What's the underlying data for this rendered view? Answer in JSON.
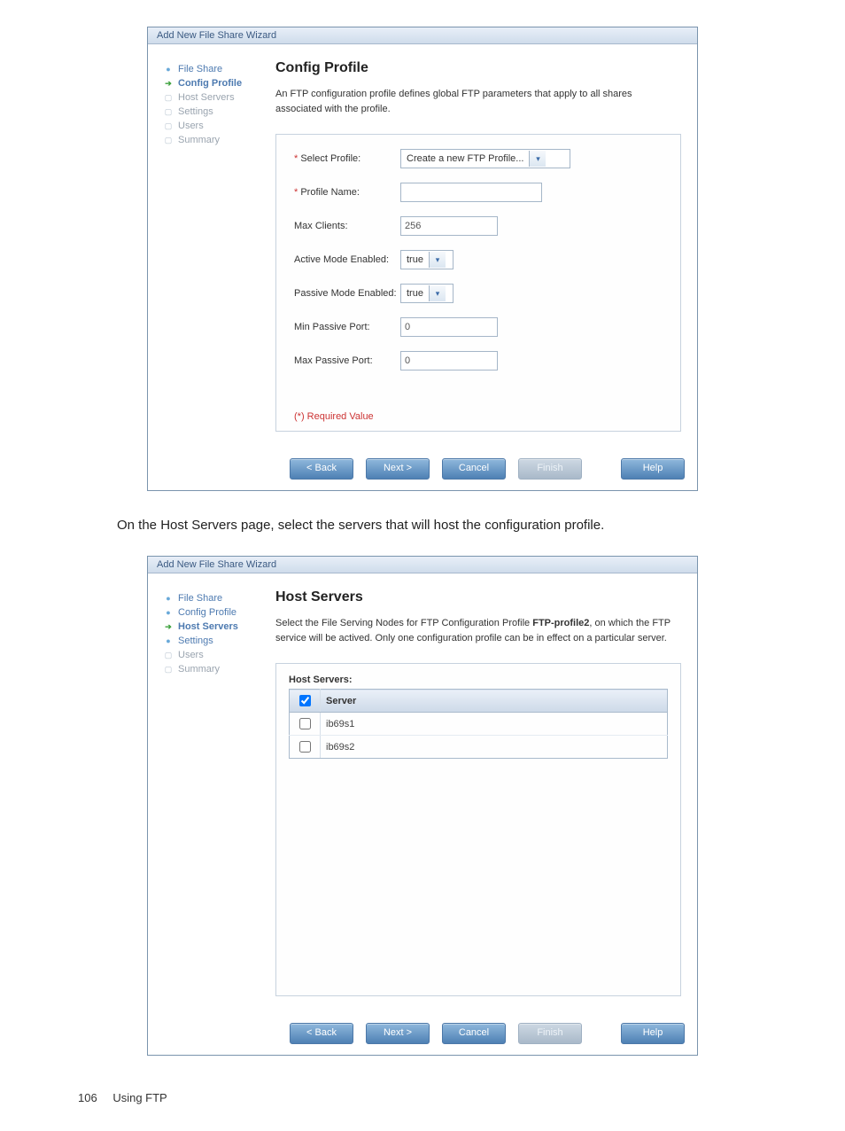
{
  "wizard1": {
    "title": "Add New File Share Wizard",
    "nav": [
      {
        "label": "File Share",
        "state": "done",
        "icon": "●"
      },
      {
        "label": "Config Profile",
        "state": "current",
        "icon": "➔"
      },
      {
        "label": "Host Servers",
        "state": "pending",
        "icon": "▢"
      },
      {
        "label": "Settings",
        "state": "pending",
        "icon": "▢"
      },
      {
        "label": "Users",
        "state": "pending",
        "icon": "▢"
      },
      {
        "label": "Summary",
        "state": "pending",
        "icon": "▢"
      }
    ],
    "panel_title": "Config Profile",
    "panel_desc": "An FTP configuration profile defines global FTP parameters that apply to all shares associated with the profile.",
    "fields": {
      "select_profile": {
        "label": "Select Profile:",
        "value": "Create a new FTP Profile..."
      },
      "profile_name": {
        "label": "Profile Name:",
        "value": ""
      },
      "max_clients": {
        "label": "Max Clients:",
        "value": "256"
      },
      "active_mode": {
        "label": "Active Mode Enabled:",
        "value": "true"
      },
      "passive_mode": {
        "label": "Passive Mode Enabled:",
        "value": "true"
      },
      "min_port": {
        "label": "Min Passive Port:",
        "value": "0"
      },
      "max_port": {
        "label": "Max Passive Port:",
        "value": "0"
      }
    },
    "required_note": "(*) Required Value",
    "buttons": {
      "back": "< Back",
      "next": "Next >",
      "cancel": "Cancel",
      "finish": "Finish",
      "help": "Help"
    }
  },
  "caption": "On the Host Servers page, select the servers that will host the configuration profile.",
  "wizard2": {
    "title": "Add New File Share Wizard",
    "nav": [
      {
        "label": "File Share",
        "state": "done",
        "icon": "●"
      },
      {
        "label": "Config Profile",
        "state": "done",
        "icon": "●"
      },
      {
        "label": "Host Servers",
        "state": "current",
        "icon": "➔"
      },
      {
        "label": "Settings",
        "state": "done",
        "icon": "●"
      },
      {
        "label": "Users",
        "state": "pending",
        "icon": "▢"
      },
      {
        "label": "Summary",
        "state": "pending",
        "icon": "▢"
      }
    ],
    "panel_title": "Host Servers",
    "panel_desc_pre": "Select the File Serving Nodes for FTP Configuration Profile ",
    "panel_desc_bold": "FTP-profile2",
    "panel_desc_post": ", on which the FTP service will be actived. Only one configuration profile can be in effect on a particular server.",
    "table": {
      "title": "Host Servers:",
      "header": "Server",
      "rows": [
        {
          "checked": false,
          "name": "ib69s1"
        },
        {
          "checked": false,
          "name": "ib69s2"
        }
      ]
    },
    "buttons": {
      "back": "< Back",
      "next": "Next >",
      "cancel": "Cancel",
      "finish": "Finish",
      "help": "Help"
    }
  },
  "footer": {
    "page": "106",
    "text": "Using FTP"
  }
}
